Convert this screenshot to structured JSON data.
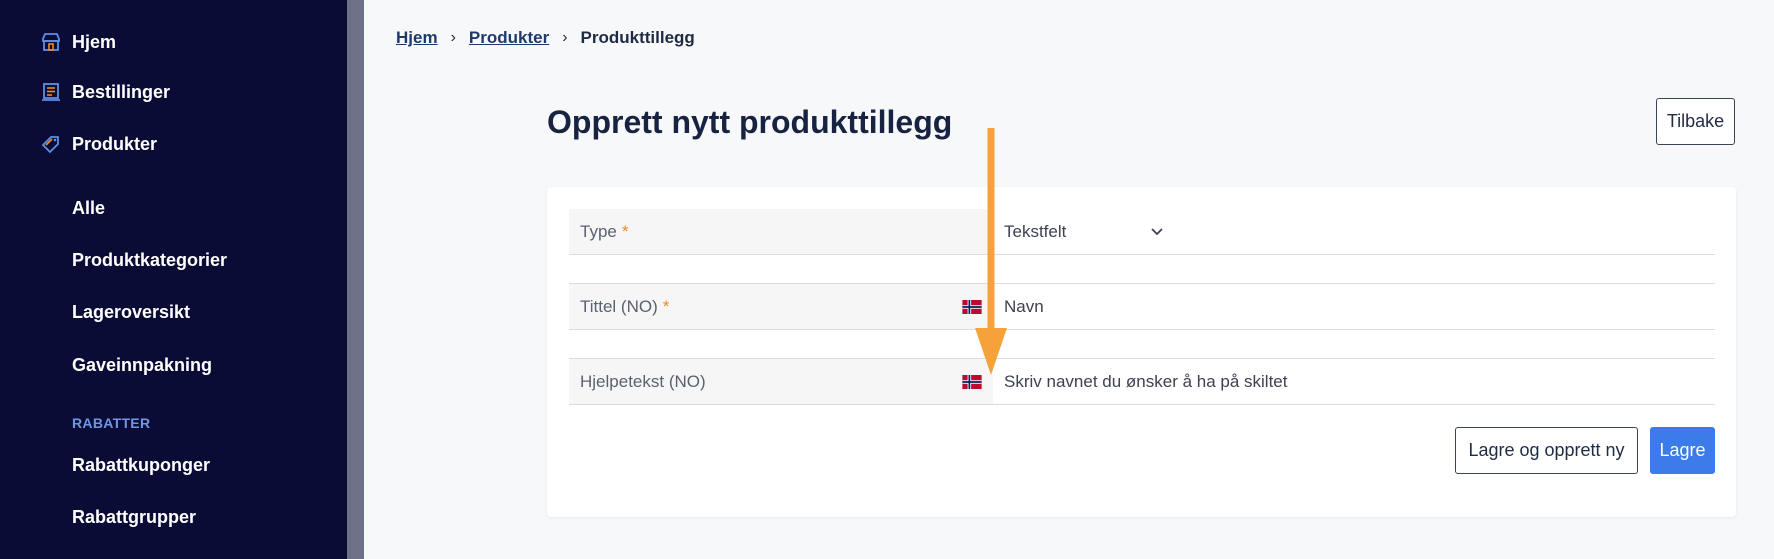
{
  "sidebar": {
    "main_items": [
      {
        "label": "Hjem",
        "icon": "store-icon"
      },
      {
        "label": "Bestillinger",
        "icon": "receipt-icon"
      },
      {
        "label": "Produkter",
        "icon": "tag-icon"
      }
    ],
    "sub_items": [
      {
        "label": "Alle"
      },
      {
        "label": "Produktkategorier"
      },
      {
        "label": "Lageroversikt"
      },
      {
        "label": "Gaveinnpakning"
      }
    ],
    "section_label": "RABATTER",
    "discount_items": [
      {
        "label": "Rabattkuponger"
      },
      {
        "label": "Rabattgrupper"
      }
    ]
  },
  "breadcrumb": {
    "items": [
      "Hjem",
      "Produkter",
      "Produkttillegg"
    ]
  },
  "page": {
    "title": "Opprett nytt produkttillegg",
    "back_label": "Tilbake"
  },
  "form": {
    "rows": [
      {
        "label": "Type",
        "required_mark": "*",
        "value": "Tekstfelt"
      },
      {
        "label": "Tittel (NO)",
        "required_mark": "*",
        "value": "Navn"
      },
      {
        "label": "Hjelpetekst (NO)",
        "required_mark": "",
        "value": "Skriv navnet du ønsker å ha på skiltet"
      }
    ],
    "save_new_label": "Lagre og opprett ny",
    "save_label": "Lagre"
  },
  "colors": {
    "sidebar_bg": "#0a0c35",
    "accent": "#3b7bea",
    "required": "#f08a24",
    "annotation_arrow": "#f6a23a"
  }
}
